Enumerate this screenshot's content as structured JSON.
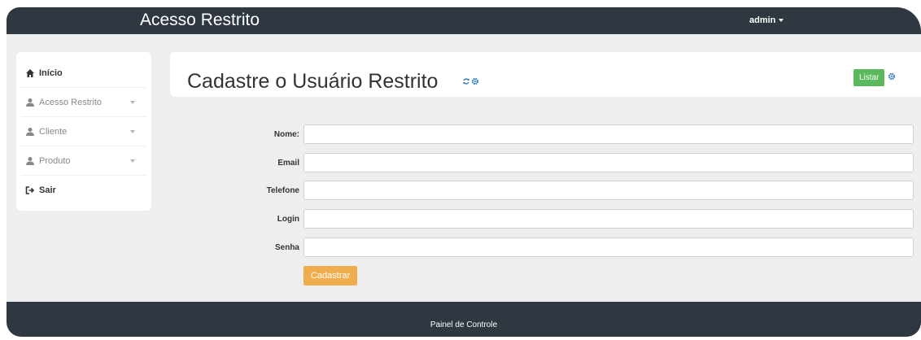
{
  "navbar": {
    "brand": "Acesso Restrito",
    "user": "admin"
  },
  "sidebar": {
    "items": [
      {
        "label": "Início",
        "icon": "home-icon"
      },
      {
        "label": "Acesso Restrito",
        "icon": "user-icon"
      },
      {
        "label": "Cliente",
        "icon": "user-icon"
      },
      {
        "label": "Produto",
        "icon": "user-icon"
      },
      {
        "label": "Sair",
        "icon": "logout-icon"
      }
    ]
  },
  "panel": {
    "title": "Cadastre o Usuário Restrito",
    "list_button": "Listar"
  },
  "form": {
    "fields": [
      {
        "label": "Nome:",
        "value": ""
      },
      {
        "label": "Email",
        "value": ""
      },
      {
        "label": "Telefone",
        "value": ""
      },
      {
        "label": "Login",
        "value": ""
      },
      {
        "label": "Senha",
        "value": ""
      }
    ],
    "submit_label": "Cadastrar"
  },
  "footer": {
    "text": "Painel de Controle"
  },
  "colors": {
    "navbar": "#2f3740",
    "background": "#eeeeee",
    "success": "#5cb85c",
    "warning": "#f0ad4e",
    "icon_blue": "#337ab7"
  }
}
